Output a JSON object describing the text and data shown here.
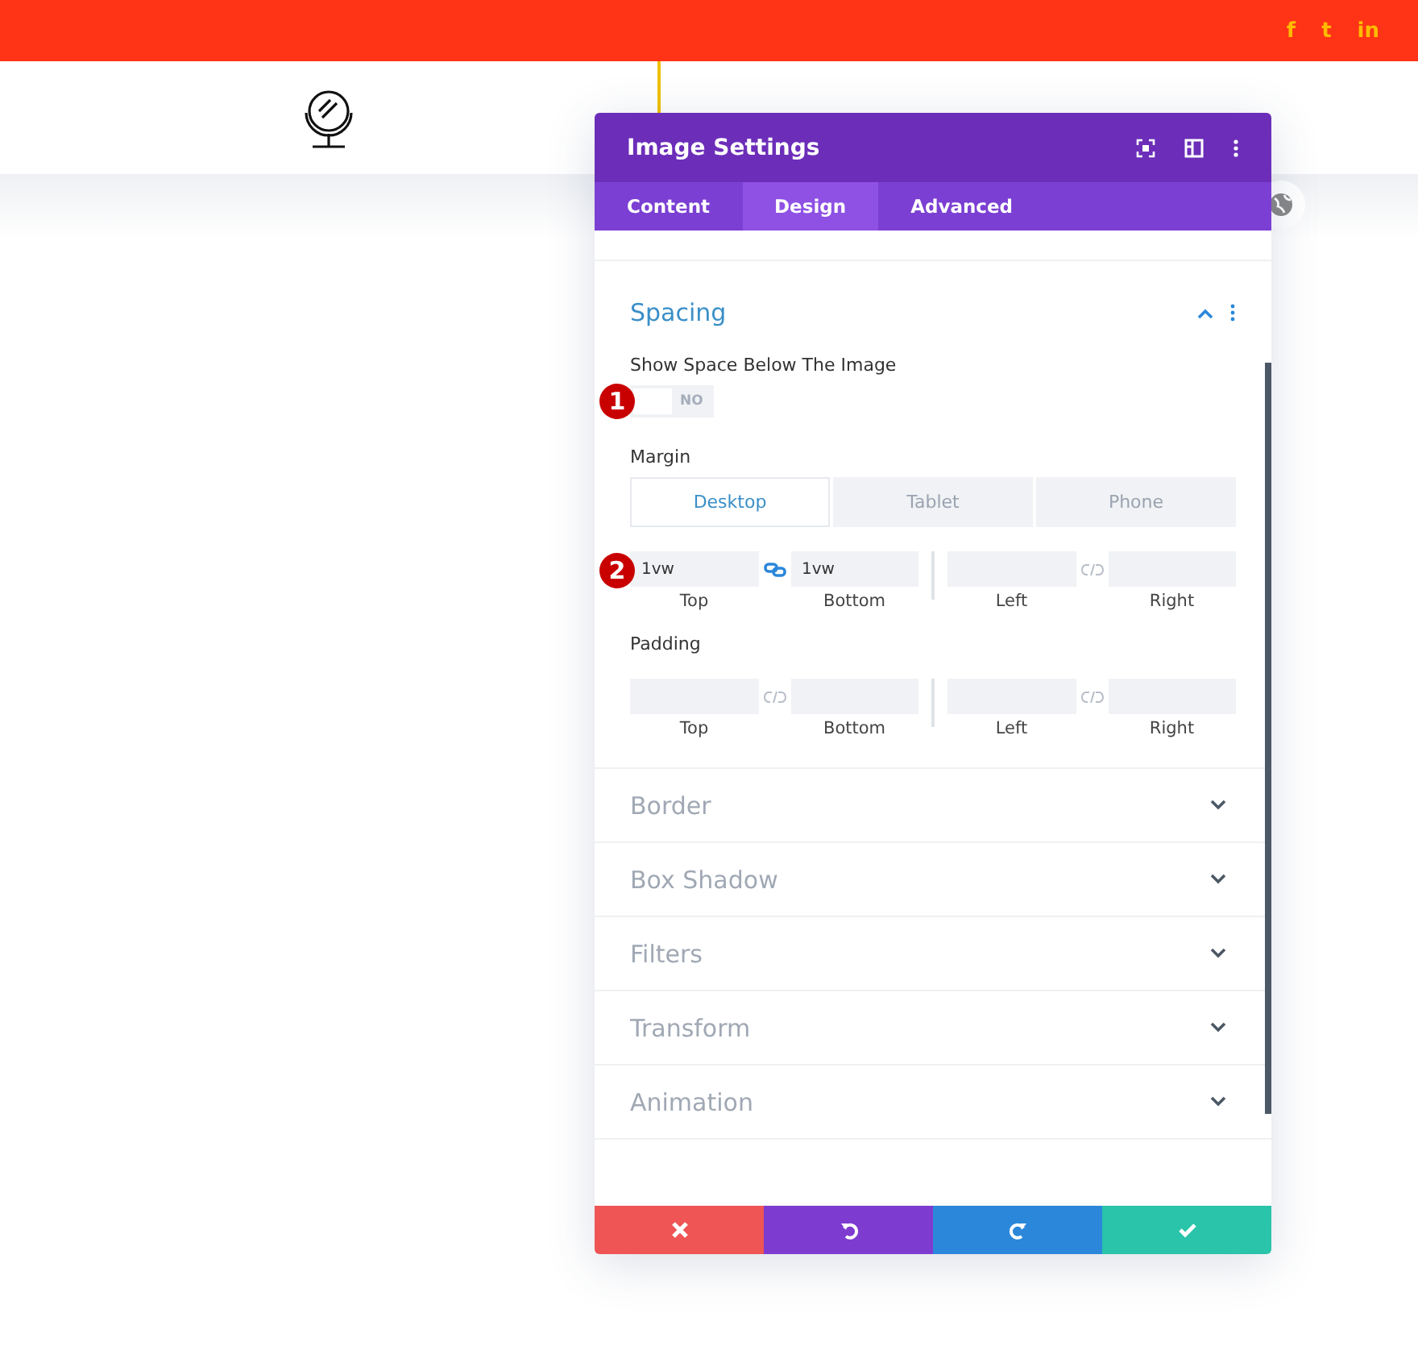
{
  "topbar": {
    "social": [
      "f",
      "t",
      "in"
    ]
  },
  "panel": {
    "title": "Image Settings",
    "tabs": [
      {
        "label": "Content",
        "selected": false
      },
      {
        "label": "Design",
        "selected": true
      },
      {
        "label": "Advanced",
        "selected": false
      }
    ],
    "spacing": {
      "title": "Spacing",
      "expanded": true,
      "toggle": {
        "label": "Show Space Below The Image",
        "on": false,
        "state_text": "NO",
        "badge": "1"
      },
      "margin": {
        "label": "Margin",
        "badge": "2",
        "devices": [
          {
            "label": "Desktop",
            "selected": true
          },
          {
            "label": "Tablet",
            "selected": false
          },
          {
            "label": "Phone",
            "selected": false
          }
        ],
        "pairs": [
          {
            "linked": true,
            "fields": [
              {
                "value": "1vw",
                "caption": "Top"
              },
              {
                "value": "1vw",
                "caption": "Bottom"
              }
            ]
          },
          {
            "linked": false,
            "fields": [
              {
                "caption": "Left"
              },
              {
                "caption": "Right"
              }
            ]
          }
        ]
      },
      "padding": {
        "label": "Padding",
        "pairs": [
          {
            "linked": false,
            "fields": [
              {
                "caption": "Top"
              },
              {
                "caption": "Bottom"
              }
            ]
          },
          {
            "linked": false,
            "fields": [
              {
                "caption": "Left"
              },
              {
                "caption": "Right"
              }
            ]
          }
        ]
      }
    },
    "sections": [
      {
        "title": "Border",
        "expanded": false
      },
      {
        "title": "Box Shadow",
        "expanded": false
      },
      {
        "title": "Filters",
        "expanded": false
      },
      {
        "title": "Transform",
        "expanded": false
      },
      {
        "title": "Animation",
        "expanded": false
      }
    ],
    "footer": [
      {
        "kind": "cancel"
      },
      {
        "kind": "undo"
      },
      {
        "kind": "redo"
      },
      {
        "kind": "save"
      }
    ]
  }
}
